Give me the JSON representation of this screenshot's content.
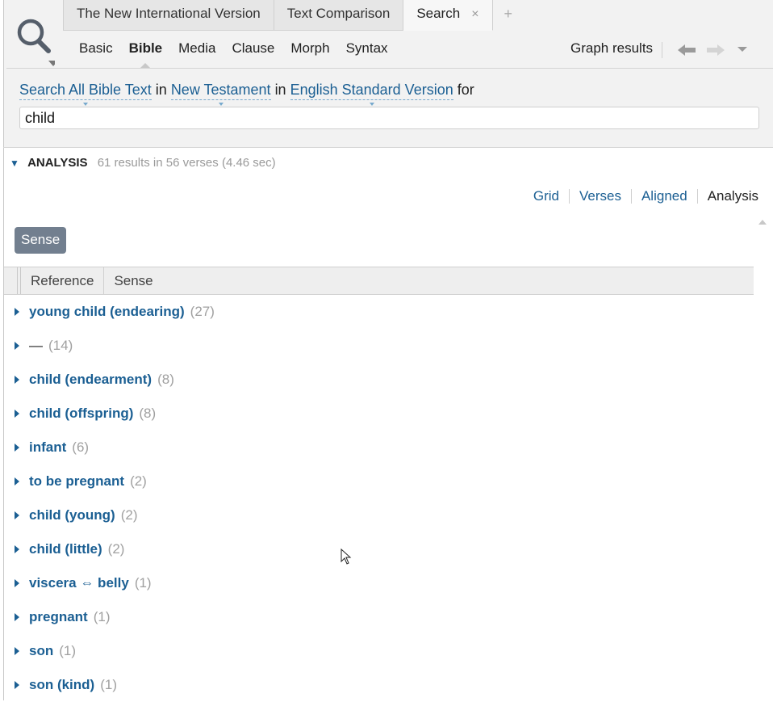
{
  "tabs": [
    {
      "label": "The New International Version"
    },
    {
      "label": "Text Comparison"
    },
    {
      "label": "Search",
      "close": "×"
    }
  ],
  "add_tab": "+",
  "search_modes": [
    "Basic",
    "Bible",
    "Media",
    "Clause",
    "Morph",
    "Syntax"
  ],
  "active_mode": "Bible",
  "graph_results": "Graph results",
  "criteria": {
    "scope": "Search All Bible Text",
    "in1": "in",
    "range": "New Testament",
    "in2": "in",
    "resource": "English Standard Version",
    "for": "for"
  },
  "query": "child",
  "analysis": {
    "label": "ANALYSIS",
    "summary": "61 results in 56 verses (4.46 sec)"
  },
  "views": [
    "Grid",
    "Verses",
    "Aligned",
    "Analysis"
  ],
  "active_view": "Analysis",
  "group_button": "Sense",
  "columns": [
    "Reference",
    "Sense"
  ],
  "rows": [
    {
      "sense": "young child (endearing)",
      "count": "(27)"
    },
    {
      "sense": "—",
      "count": "(14)"
    },
    {
      "sense": "child (endearment)",
      "count": "(8)"
    },
    {
      "sense": "child (offspring)",
      "count": "(8)"
    },
    {
      "sense": "infant",
      "count": "(6)"
    },
    {
      "sense": "to be pregnant",
      "count": "(2)"
    },
    {
      "sense": "child (young)",
      "count": "(2)"
    },
    {
      "sense": "child (little)",
      "count": "(2)"
    },
    {
      "sense": "viscera ⇔ belly",
      "count": "(1)"
    },
    {
      "sense": "pregnant",
      "count": "(1)"
    },
    {
      "sense": "son",
      "count": "(1)"
    },
    {
      "sense": "son (kind)",
      "count": "(1)"
    }
  ],
  "colors": {
    "link": "#1b5f93",
    "count": "#a0a0a0",
    "sense_button": "#727f8f"
  }
}
